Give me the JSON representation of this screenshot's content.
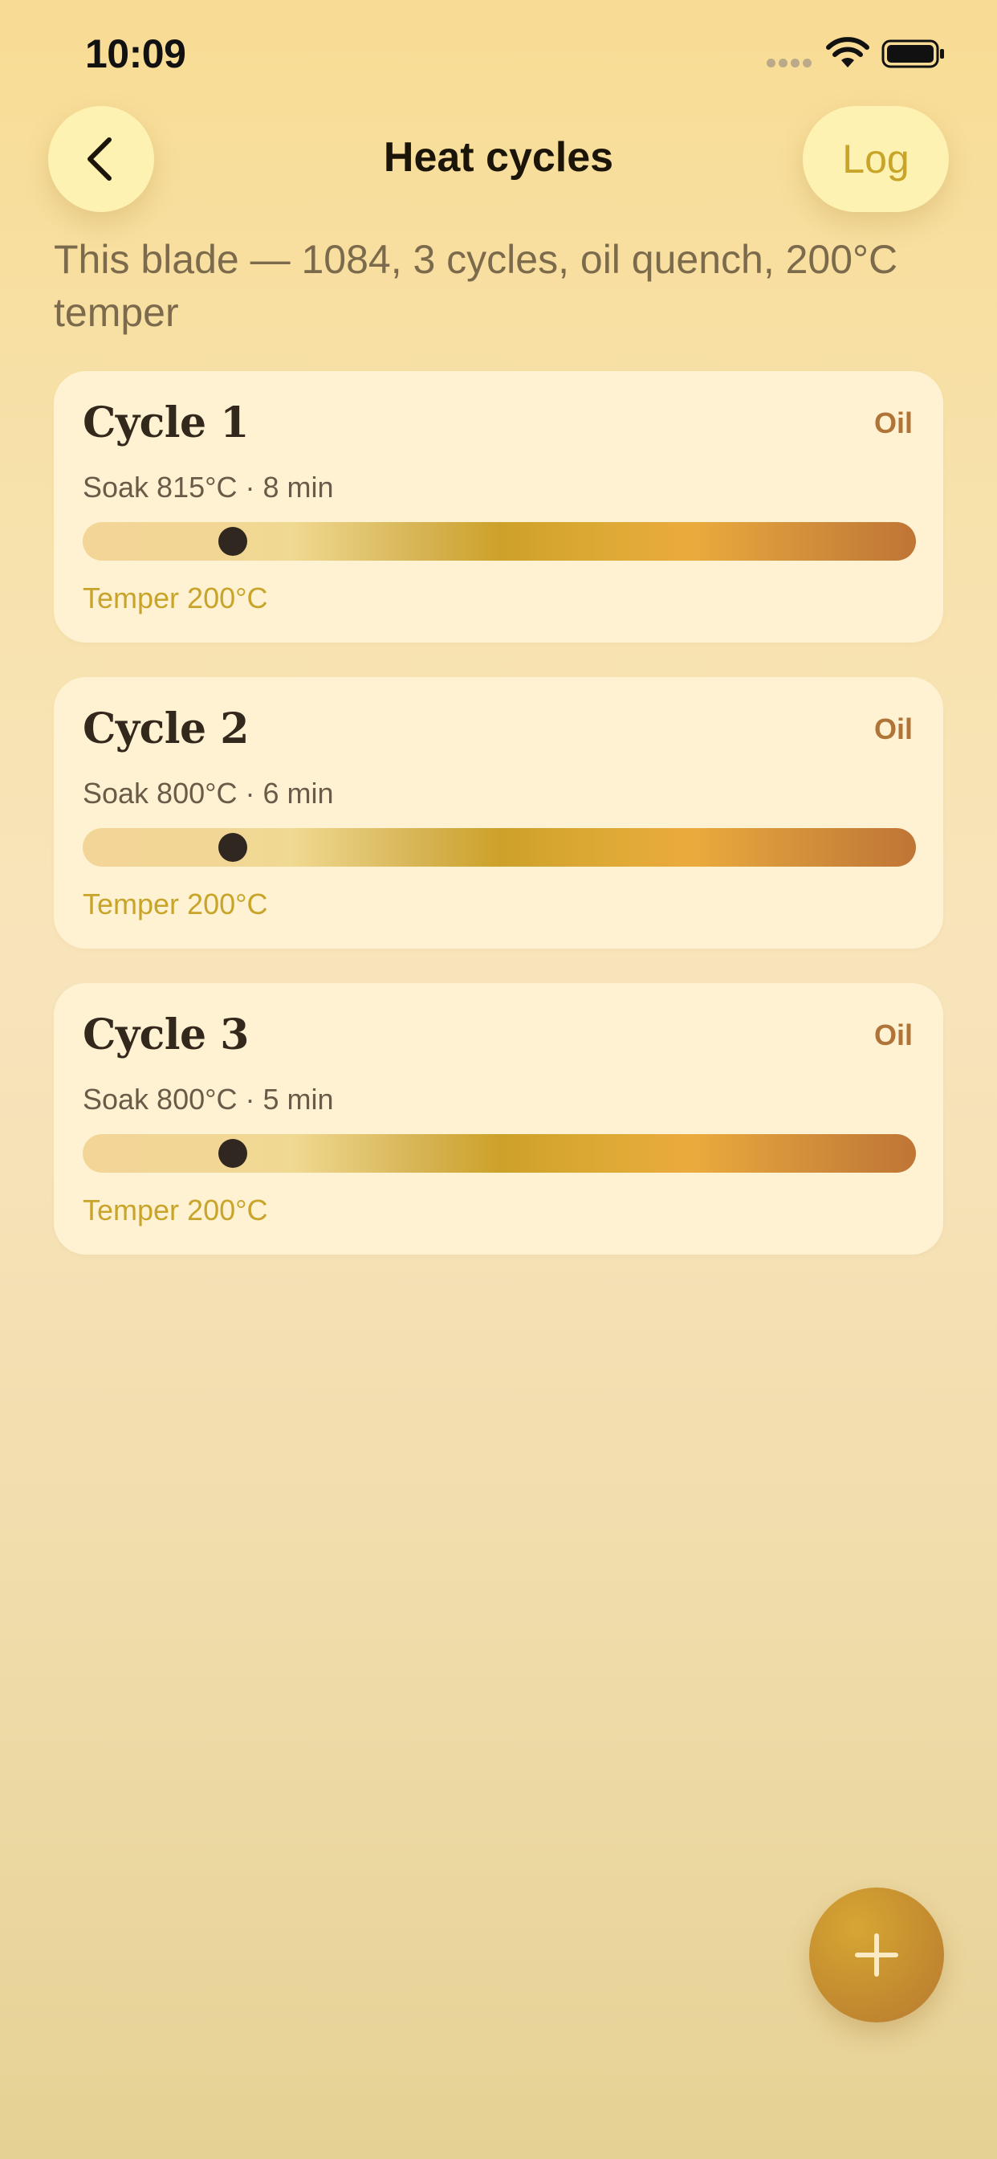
{
  "status_bar": {
    "time": "10:09",
    "icons": [
      "signal-dots-icon",
      "wifi-icon",
      "battery-icon"
    ]
  },
  "nav": {
    "back_icon": "chevron-left-icon",
    "title": "Heat cycles",
    "log_label": "Log"
  },
  "summary": "This blade — 1084, 3 cycles, oil quench, 200°C temper",
  "cycles": [
    {
      "name": "Cycle 1",
      "quench": "Oil",
      "soak": "Soak 815°C · 8 min",
      "temper": "Temper 200°C",
      "marker_fraction": 0.18
    },
    {
      "name": "Cycle 2",
      "quench": "Oil",
      "soak": "Soak 800°C · 6 min",
      "temper": "Temper 200°C",
      "marker_fraction": 0.18
    },
    {
      "name": "Cycle 3",
      "quench": "Oil",
      "soak": "Soak 800°C · 5 min",
      "temper": "Temper 200°C",
      "marker_fraction": 0.18
    }
  ],
  "fab": {
    "icon": "plus-icon"
  },
  "colors": {
    "accent": "#c8a428",
    "quench": "#b07438",
    "card": "#fff2d3",
    "button": "#fdf2b2",
    "fab": "#c58d2f",
    "marker": "#2f2720"
  }
}
